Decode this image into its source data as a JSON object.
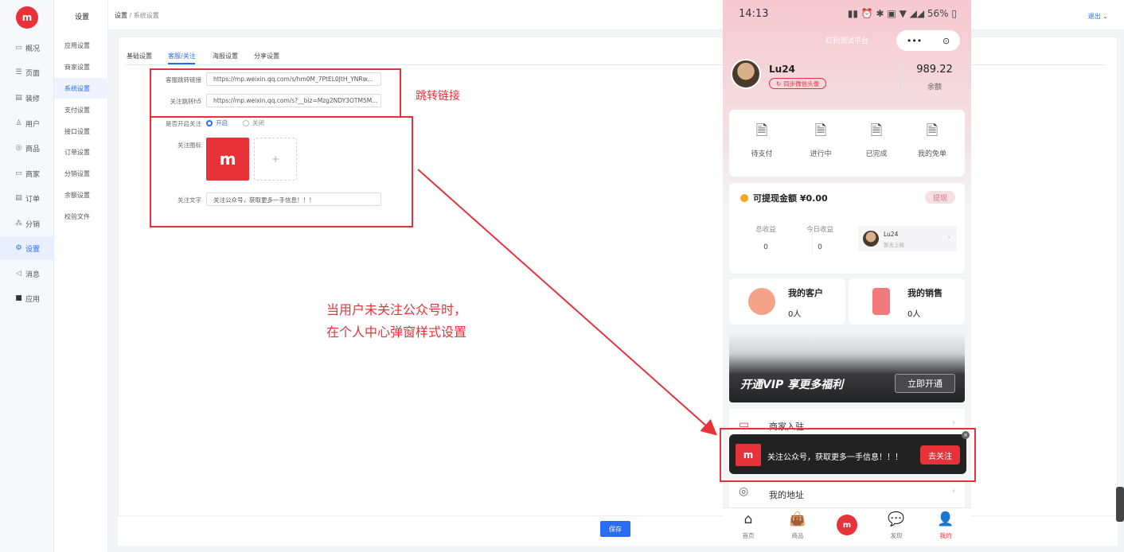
{
  "brand": {
    "logo": "m",
    "accent": "#e8323a",
    "primary": "#2a6df4"
  },
  "rail": {
    "items": [
      {
        "icon": "overview-icon",
        "label": "概况"
      },
      {
        "icon": "page-icon",
        "label": "页面"
      },
      {
        "icon": "decor-icon",
        "label": "装修"
      },
      {
        "icon": "user-icon",
        "label": "用户"
      },
      {
        "icon": "goods-icon",
        "label": "商品"
      },
      {
        "icon": "merchant-icon",
        "label": "商家"
      },
      {
        "icon": "order-icon",
        "label": "订单"
      },
      {
        "icon": "distribution-icon",
        "label": "分销"
      },
      {
        "icon": "settings-icon",
        "label": "设置"
      },
      {
        "icon": "message-icon",
        "label": "消息"
      },
      {
        "icon": "apps-icon",
        "label": "应用"
      }
    ]
  },
  "submenu": {
    "title": "设置",
    "items": [
      "应用设置",
      "商家设置",
      "系统设置",
      "支付设置",
      "接口设置",
      "订单设置",
      "分销设置",
      "余额设置",
      "校验文件"
    ]
  },
  "breadcrumb": {
    "first": "设置",
    "sep": "/",
    "second": "系统设置"
  },
  "header": {
    "logout": "退出"
  },
  "tabs": [
    "基础设置",
    "客服/关注",
    "海报设置",
    "分享设置"
  ],
  "form": {
    "kefu_label": "客服跳转链接",
    "kefu_value": "https://mp.weixin.qq.com/s/hm0M_7PtEL0JtH_YNRw...",
    "follow_label": "关注跳转h5",
    "follow_value": "https://mp.weixin.qq.com/s?__biz=Mzg2NDY3OTM5M...",
    "enable_label": "是否开启关注",
    "enable_on": "开启",
    "enable_off": "关闭",
    "icon_label": "关注图标",
    "icon_logo": "m",
    "icon_add": "+",
    "text_label": "关注文字",
    "text_value": "关注公众号，获取更多一手信息！！！"
  },
  "save_label": "保存",
  "annotations": {
    "jump": "跳转链接",
    "popup_line1": "当用户未关注公众号时，",
    "popup_line2": "在个人中心弹窗样式设置"
  },
  "phone": {
    "status_time": "14:13",
    "status_right": "56%",
    "mini_title": "红利测试平台",
    "capsule_more": "•••",
    "capsule_close": "⊙",
    "user_name": "Lu24",
    "sync_label": "同步微信头像",
    "balance": "989.22",
    "balance_label": "余额",
    "orders": [
      "待支付",
      "进行中",
      "已完成",
      "我的免单"
    ],
    "withdraw_title": "可提现金额 ¥0.00",
    "withdraw_btn": "提现",
    "total_label": "总收益",
    "total_value": "0",
    "today_label": "今日收益",
    "today_value": "0",
    "ref_name": "Lu24",
    "ref_sub": "暂无上级",
    "customers_title": "我的客户",
    "customers_value": "0人",
    "sales_title": "我的销售",
    "sales_value": "0人",
    "vip_text": "开通VIP 享更多福利",
    "vip_btn": "立即开通",
    "merchant_join": "商家入驻",
    "popup_text": "关注公众号，获取更多一手信息！！！",
    "popup_btn": "去关注",
    "popup_logo": "m",
    "address": "我的地址",
    "tabbar": [
      "首页",
      "商品",
      "",
      "发现",
      "我的"
    ]
  }
}
